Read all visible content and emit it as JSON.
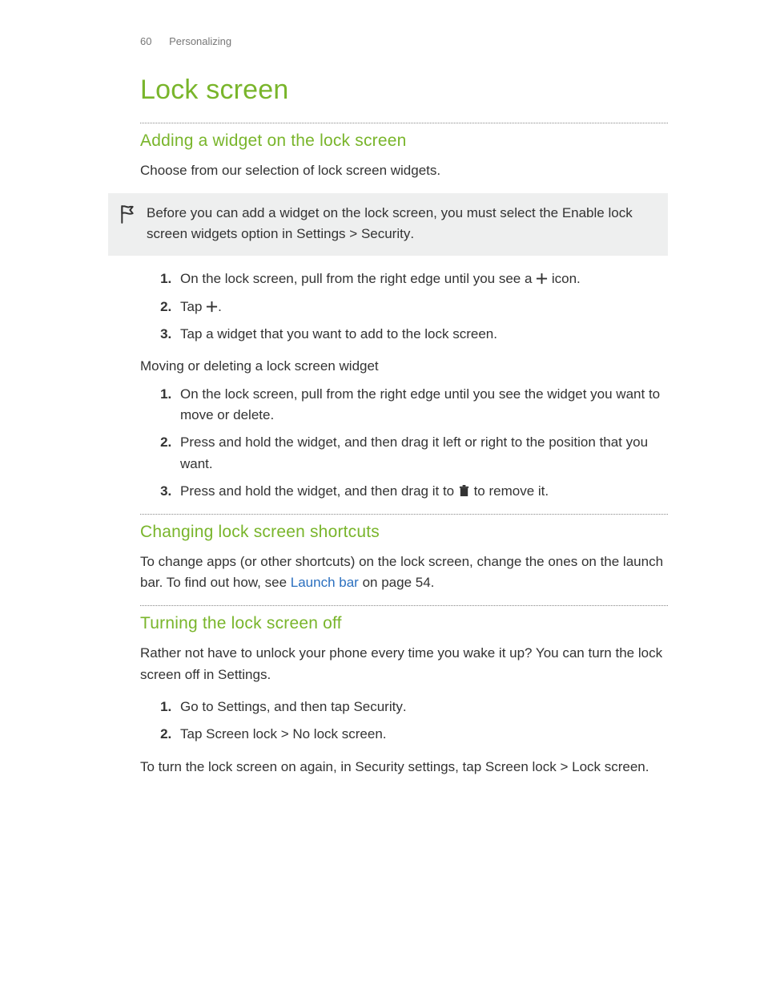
{
  "header": {
    "page_number": "60",
    "chapter": "Personalizing"
  },
  "title": "Lock screen",
  "s1": {
    "heading": "Adding a widget on the lock screen",
    "intro": "Choose from our selection of lock screen widgets.",
    "note_pre": "Before you can add a widget on the lock screen, you must select the ",
    "note_bold": "Enable lock screen widgets",
    "note_mid": " option in ",
    "note_b2": "Settings",
    "note_gt": " > ",
    "note_b3": "Security",
    "note_end": ".",
    "step1_pre": "On the lock screen, pull from the right edge until you see a ",
    "step1_post": " icon.",
    "step2_pre": "Tap ",
    "step2_post": ".",
    "step3": "Tap a widget that you want to add to the lock screen.",
    "sub_heading": "Moving or deleting a lock screen widget",
    "mstep1": "On the lock screen, pull from the right edge until you see the widget you want to move or delete.",
    "mstep2": "Press and hold the widget, and then drag it left or right to the position that you want.",
    "mstep3_pre": "Press and hold the widget, and then drag it to ",
    "mstep3_post": " to remove it."
  },
  "s2": {
    "heading": "Changing lock screen shortcuts",
    "para_pre": "To change apps (or other shortcuts) on the lock screen, change the ones on the launch bar. To find out how, see ",
    "link_text": "Launch bar",
    "para_post": " on page 54."
  },
  "s3": {
    "heading": "Turning the lock screen off",
    "intro": "Rather not have to unlock your phone every time you wake it up? You can turn the lock screen off in Settings.",
    "step1_pre": "Go to Settings, and then tap ",
    "step1_bold": "Security",
    "step1_post": ".",
    "step2_pre": "Tap ",
    "step2_b1": "Screen lock",
    "step2_gt": " > ",
    "step2_b2": "No lock screen",
    "step2_post": ".",
    "outro_pre": "To turn the lock screen on again, in Security settings, tap ",
    "outro_b1": "Screen lock",
    "outro_gt": " > ",
    "outro_b2": "Lock screen",
    "outro_post": "."
  }
}
